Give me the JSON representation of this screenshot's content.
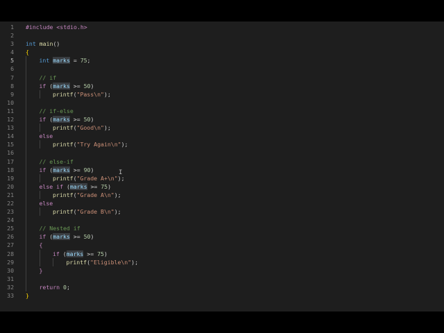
{
  "editor": {
    "active_line": 5,
    "lines": [
      {
        "num": "1",
        "indent": 0,
        "tokens": [
          {
            "t": "#include &lt;stdio.h&gt;",
            "c": "pp",
            "raw": "#include <stdio.h>"
          }
        ]
      },
      {
        "num": "2",
        "indent": 0,
        "tokens": []
      },
      {
        "num": "3",
        "indent": 0,
        "tokens": [
          {
            "raw": "int",
            "c": "kw"
          },
          {
            "raw": " "
          },
          {
            "raw": "main",
            "c": "fn"
          },
          {
            "raw": "()"
          }
        ]
      },
      {
        "num": "4",
        "indent": 0,
        "tokens": [
          {
            "raw": "{",
            "c": "brace"
          }
        ]
      },
      {
        "num": "5",
        "indent": 1,
        "tokens": [
          {
            "raw": "int",
            "c": "kw"
          },
          {
            "raw": " "
          },
          {
            "raw": "marks",
            "c": "var",
            "hl": true
          },
          {
            "raw": " = "
          },
          {
            "raw": "75",
            "c": "num"
          },
          {
            "raw": ";"
          }
        ]
      },
      {
        "num": "6",
        "indent": 1,
        "tokens": []
      },
      {
        "num": "7",
        "indent": 1,
        "tokens": [
          {
            "raw": "// if",
            "c": "com"
          }
        ]
      },
      {
        "num": "8",
        "indent": 1,
        "tokens": [
          {
            "raw": "if",
            "c": "ctl"
          },
          {
            "raw": " ("
          },
          {
            "raw": "marks",
            "c": "var",
            "hl": true
          },
          {
            "raw": " >= "
          },
          {
            "raw": "50",
            "c": "num"
          },
          {
            "raw": ")"
          }
        ]
      },
      {
        "num": "9",
        "indent": 2,
        "tokens": [
          {
            "raw": "printf",
            "c": "fn"
          },
          {
            "raw": "("
          },
          {
            "raw": "\"Pass\\n\"",
            "c": "str"
          },
          {
            "raw": ");"
          }
        ]
      },
      {
        "num": "10",
        "indent": 1,
        "tokens": []
      },
      {
        "num": "11",
        "indent": 1,
        "tokens": [
          {
            "raw": "// if-else",
            "c": "com"
          }
        ]
      },
      {
        "num": "12",
        "indent": 1,
        "tokens": [
          {
            "raw": "if",
            "c": "ctl"
          },
          {
            "raw": " ("
          },
          {
            "raw": "marks",
            "c": "var",
            "hl": true
          },
          {
            "raw": " >= "
          },
          {
            "raw": "50",
            "c": "num"
          },
          {
            "raw": ")"
          }
        ]
      },
      {
        "num": "13",
        "indent": 2,
        "tokens": [
          {
            "raw": "printf",
            "c": "fn"
          },
          {
            "raw": "("
          },
          {
            "raw": "\"Good\\n\"",
            "c": "str"
          },
          {
            "raw": ");"
          }
        ]
      },
      {
        "num": "14",
        "indent": 1,
        "tokens": [
          {
            "raw": "else",
            "c": "ctl"
          }
        ]
      },
      {
        "num": "15",
        "indent": 2,
        "tokens": [
          {
            "raw": "printf",
            "c": "fn"
          },
          {
            "raw": "("
          },
          {
            "raw": "\"Try Again\\n\"",
            "c": "str"
          },
          {
            "raw": ");"
          }
        ]
      },
      {
        "num": "16",
        "indent": 1,
        "tokens": []
      },
      {
        "num": "17",
        "indent": 1,
        "tokens": [
          {
            "raw": "// else-if",
            "c": "com"
          }
        ]
      },
      {
        "num": "18",
        "indent": 1,
        "tokens": [
          {
            "raw": "if",
            "c": "ctl"
          },
          {
            "raw": " ("
          },
          {
            "raw": "marks",
            "c": "var",
            "hl": true
          },
          {
            "raw": " >= "
          },
          {
            "raw": "90",
            "c": "num"
          },
          {
            "raw": ")"
          }
        ]
      },
      {
        "num": "19",
        "indent": 2,
        "tokens": [
          {
            "raw": "printf",
            "c": "fn"
          },
          {
            "raw": "("
          },
          {
            "raw": "\"Grade A+\\n\"",
            "c": "str"
          },
          {
            "raw": ");"
          }
        ]
      },
      {
        "num": "20",
        "indent": 1,
        "tokens": [
          {
            "raw": "else if",
            "c": "ctl"
          },
          {
            "raw": " ("
          },
          {
            "raw": "marks",
            "c": "var",
            "hl": true
          },
          {
            "raw": " >= "
          },
          {
            "raw": "75",
            "c": "num"
          },
          {
            "raw": ")"
          }
        ]
      },
      {
        "num": "21",
        "indent": 2,
        "tokens": [
          {
            "raw": "printf",
            "c": "fn"
          },
          {
            "raw": "("
          },
          {
            "raw": "\"Grade A\\n\"",
            "c": "str"
          },
          {
            "raw": ");"
          }
        ]
      },
      {
        "num": "22",
        "indent": 1,
        "tokens": [
          {
            "raw": "else",
            "c": "ctl"
          }
        ]
      },
      {
        "num": "23",
        "indent": 2,
        "tokens": [
          {
            "raw": "printf",
            "c": "fn"
          },
          {
            "raw": "("
          },
          {
            "raw": "\"Grade B\\n\"",
            "c": "str"
          },
          {
            "raw": ");"
          }
        ]
      },
      {
        "num": "24",
        "indent": 1,
        "tokens": []
      },
      {
        "num": "25",
        "indent": 1,
        "tokens": [
          {
            "raw": "// Nested if",
            "c": "com"
          }
        ]
      },
      {
        "num": "26",
        "indent": 1,
        "tokens": [
          {
            "raw": "if",
            "c": "ctl"
          },
          {
            "raw": " ("
          },
          {
            "raw": "marks",
            "c": "var",
            "hl": true
          },
          {
            "raw": " >= "
          },
          {
            "raw": "50",
            "c": "num"
          },
          {
            "raw": ")"
          }
        ]
      },
      {
        "num": "27",
        "indent": 1,
        "tokens": [
          {
            "raw": "{",
            "c": "ctl"
          }
        ]
      },
      {
        "num": "28",
        "indent": 2,
        "tokens": [
          {
            "raw": "if",
            "c": "ctl"
          },
          {
            "raw": " ("
          },
          {
            "raw": "marks",
            "c": "var",
            "hl": true
          },
          {
            "raw": " >= "
          },
          {
            "raw": "75",
            "c": "num"
          },
          {
            "raw": ")"
          }
        ]
      },
      {
        "num": "29",
        "indent": 3,
        "tokens": [
          {
            "raw": "printf",
            "c": "fn"
          },
          {
            "raw": "("
          },
          {
            "raw": "\"Eligible\\n\"",
            "c": "str"
          },
          {
            "raw": ");"
          }
        ]
      },
      {
        "num": "30",
        "indent": 1,
        "tokens": [
          {
            "raw": "}",
            "c": "ctl"
          }
        ]
      },
      {
        "num": "31",
        "indent": 1,
        "tokens": []
      },
      {
        "num": "32",
        "indent": 1,
        "tokens": [
          {
            "raw": "return",
            "c": "ctl"
          },
          {
            "raw": " "
          },
          {
            "raw": "0",
            "c": "num"
          },
          {
            "raw": ";"
          }
        ]
      },
      {
        "num": "33",
        "indent": 0,
        "tokens": [
          {
            "raw": "}",
            "c": "brace"
          }
        ]
      }
    ]
  },
  "colors": {
    "background": "#1e1e1e",
    "keyword": "#569cd6",
    "control": "#c586c0",
    "function": "#dcdcaa",
    "string": "#ce9178",
    "number": "#b5cea8",
    "comment": "#6a9955",
    "variable": "#9cdcfe",
    "bracket": "#ffd700"
  },
  "cursor": {
    "icon": "text-cursor-icon",
    "glyph": "I"
  }
}
